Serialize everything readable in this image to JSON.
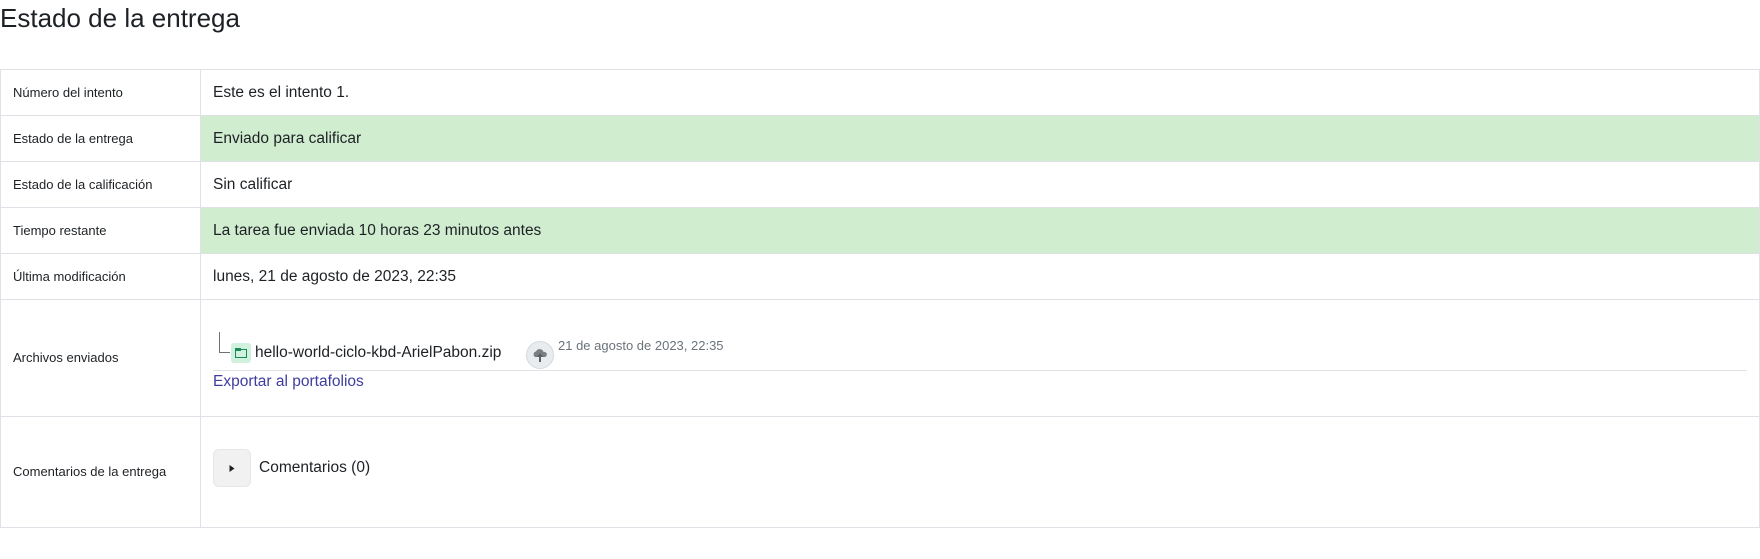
{
  "page": {
    "heading": "Estado de la entrega"
  },
  "rows": {
    "attempt": {
      "label": "Número del intento",
      "value": "Este es el intento 1."
    },
    "submission_status": {
      "label": "Estado de la entrega",
      "value": "Enviado para calificar"
    },
    "grading_status": {
      "label": "Estado de la calificación",
      "value": "Sin calificar"
    },
    "time_remaining": {
      "label": "Tiempo restante",
      "value": "La tarea fue enviada 10 horas 23 minutos antes"
    },
    "last_modified": {
      "label": "Última modificación",
      "value": "lunes, 21 de agosto de 2023, 22:35"
    },
    "files": {
      "label": "Archivos enviados",
      "file_name": "hello-world-ciclo-kbd-ArielPabon.zip",
      "file_date": "21 de agosto de 2023, 22:35",
      "export_link": "Exportar al portafolios"
    },
    "comments": {
      "label": "Comentarios de la entrega",
      "toggle_label": "Comentarios (0)"
    }
  },
  "colors": {
    "success_bg": "#d1edd0",
    "border": "#dee2e6",
    "link": "#3f3d9e",
    "text": "#1d2125"
  },
  "icons": {
    "file": "archive-file-icon",
    "upload": "upload-portfolio-icon",
    "toggle": "caret-right-icon"
  }
}
